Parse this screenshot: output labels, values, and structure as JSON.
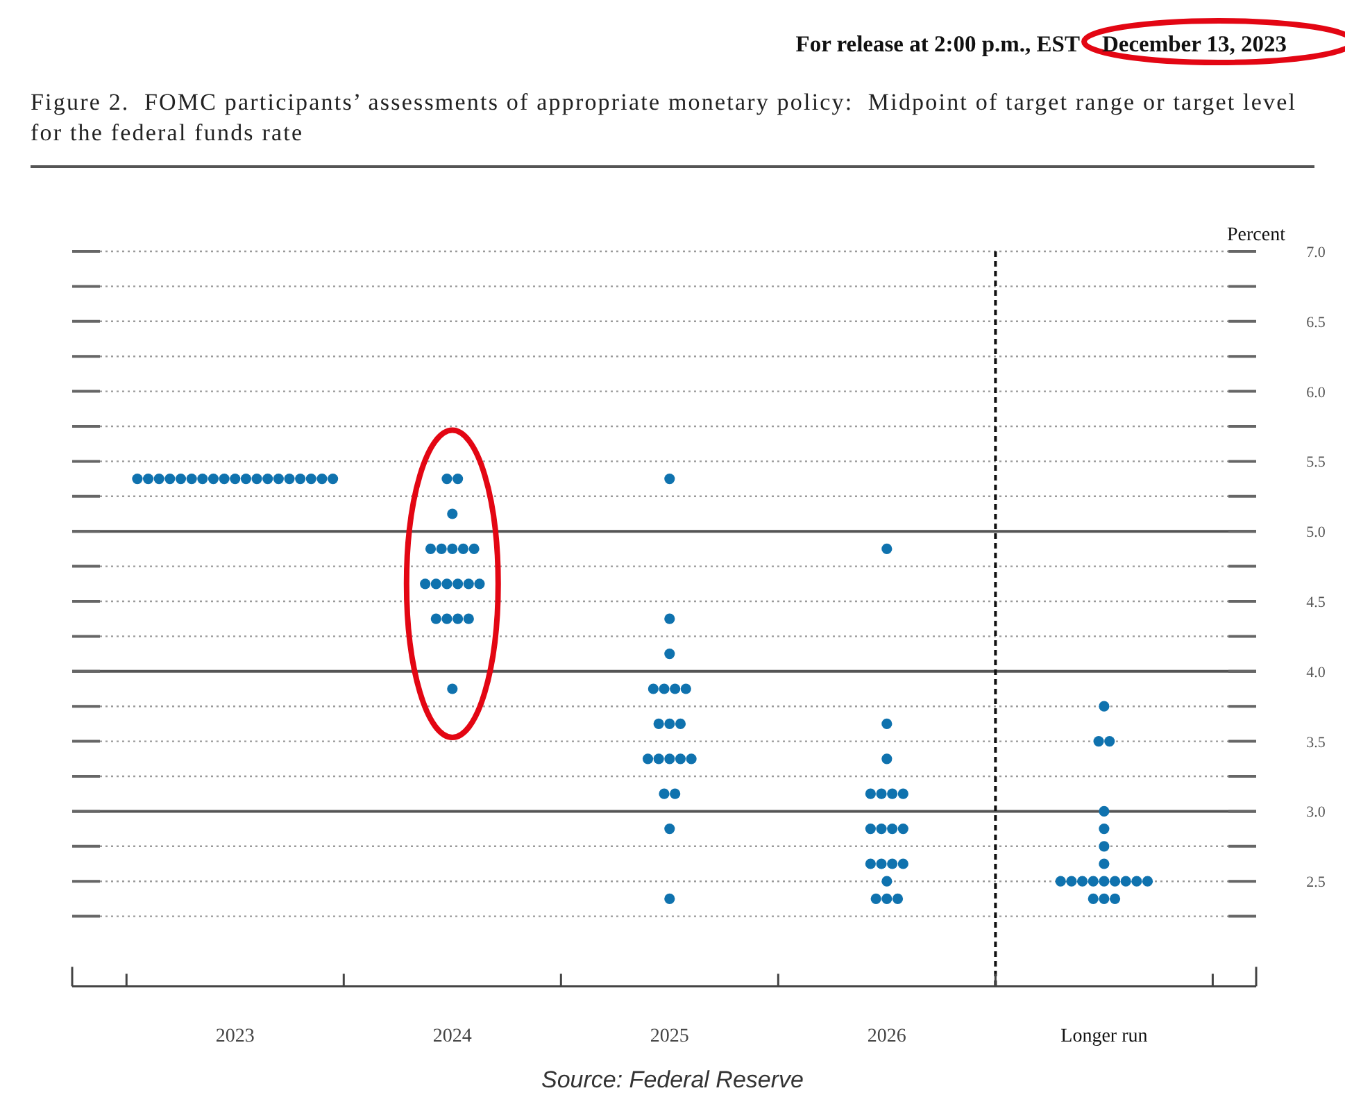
{
  "release_line": {
    "prefix": "For release at 2:00 p.m., EST",
    "date": "December 13, 2023",
    "date_circled": true
  },
  "figure_caption": "Figure 2.  FOMC participants’ assessments of appropriate monetary policy:  Midpoint of target range or target level for the federal funds rate",
  "chart_data": {
    "type": "scatter",
    "ylabel": "Percent",
    "grid": true,
    "x": [
      2022.55,
      2022.6,
      2022.65,
      2022.7,
      2022.75,
      2022.8,
      2022.85,
      2022.9,
      2022.95,
      2023,
      2023.05,
      2023.1,
      2023.15,
      2023.2,
      2023.25,
      2023.3,
      2023.35,
      2023.4,
      2023.45,
      2023.975,
      2024.025,
      2024,
      2023.9,
      2023.95,
      2024,
      2024.05,
      2024.1,
      2023.875,
      2023.925,
      2023.975,
      2024.025,
      2024.075,
      2024.125,
      2023.925,
      2023.975,
      2024.025,
      2024.075,
      2024,
      2025,
      2025,
      2025,
      2024.925,
      2024.975,
      2025.025,
      2025.075,
      2024.95,
      2025,
      2025.05,
      2024.9,
      2024.95,
      2025,
      2025.05,
      2025.1,
      2024.975,
      2025.025,
      2025,
      2025,
      2026,
      2026,
      2026,
      2025.925,
      2025.975,
      2026.025,
      2026.075,
      2025.925,
      2025.975,
      2026.025,
      2026.075,
      2025.925,
      2025.975,
      2026.025,
      2026.075,
      2026,
      2025.95,
      2026,
      2026.05,
      2027,
      2026.975,
      2027.025,
      2027,
      2027,
      2027,
      2027,
      2026.8,
      2026.85,
      2026.9,
      2026.95,
      2027,
      2027.05,
      2027.1,
      2027.15,
      2027.2,
      2026.95,
      2027,
      2027.05
    ],
    "series": [
      {
        "color": "#0f72ae",
        "values": [
          5.375,
          5.375,
          5.375,
          5.375,
          5.375,
          5.375,
          5.375,
          5.375,
          5.375,
          5.375,
          5.375,
          5.375,
          5.375,
          5.375,
          5.375,
          5.375,
          5.375,
          5.375,
          5.375,
          5.375,
          5.375,
          5.125,
          4.875,
          4.875,
          4.875,
          4.875,
          4.875,
          4.625,
          4.625,
          4.625,
          4.625,
          4.625,
          4.625,
          4.375,
          4.375,
          4.375,
          4.375,
          3.875,
          5.375,
          4.375,
          4.125,
          3.875,
          3.875,
          3.875,
          3.875,
          3.625,
          3.625,
          3.625,
          3.375,
          3.375,
          3.375,
          3.375,
          3.375,
          3.125,
          3.125,
          2.875,
          2.375,
          4.875,
          3.625,
          3.375,
          3.125,
          3.125,
          3.125,
          3.125,
          2.875,
          2.875,
          2.875,
          2.875,
          2.625,
          2.625,
          2.625,
          2.625,
          2.5,
          2.375,
          2.375,
          2.375,
          3.75,
          3.5,
          3.5,
          3.0,
          2.875,
          2.75,
          2.625,
          2.5,
          2.5,
          2.5,
          2.5,
          2.5,
          2.5,
          2.5,
          2.5,
          2.5,
          2.375,
          2.375,
          2.375
        ]
      }
    ],
    "xlim": [
      2022.25,
      2027.7
    ],
    "ref_lines": [
      {
        "axis": "x",
        "value": 2026.5
      }
    ],
    "ylim": [
      1.75,
      7.0
    ],
    "xticks": [
      2023,
      2024,
      2025,
      2026,
      {
        "value": 2027,
        "label": "Longer run"
      }
    ],
    "yticks": [
      {
        "value": 2.5,
        "label": "2.5"
      },
      {
        "value": 3.0,
        "label": "3.0"
      },
      {
        "value": 3.5,
        "label": "3.5"
      },
      {
        "value": 4.0,
        "label": "4.0"
      },
      {
        "value": 4.5,
        "label": "4.5"
      },
      {
        "value": 5.0,
        "label": "5.0"
      },
      {
        "value": 5.5,
        "label": "5.5"
      },
      {
        "value": 6.0,
        "label": "6.0"
      },
      {
        "value": 6.5,
        "label": "6.5"
      },
      {
        "value": 7.0,
        "label": "7.0"
      }
    ]
  },
  "column_highlights": [
    {
      "circled": false
    },
    {
      "circled": true
    },
    {
      "circled": false
    },
    {
      "circled": false
    },
    {
      "circled": false
    }
  ],
  "source": "Source: Federal Reserve"
}
